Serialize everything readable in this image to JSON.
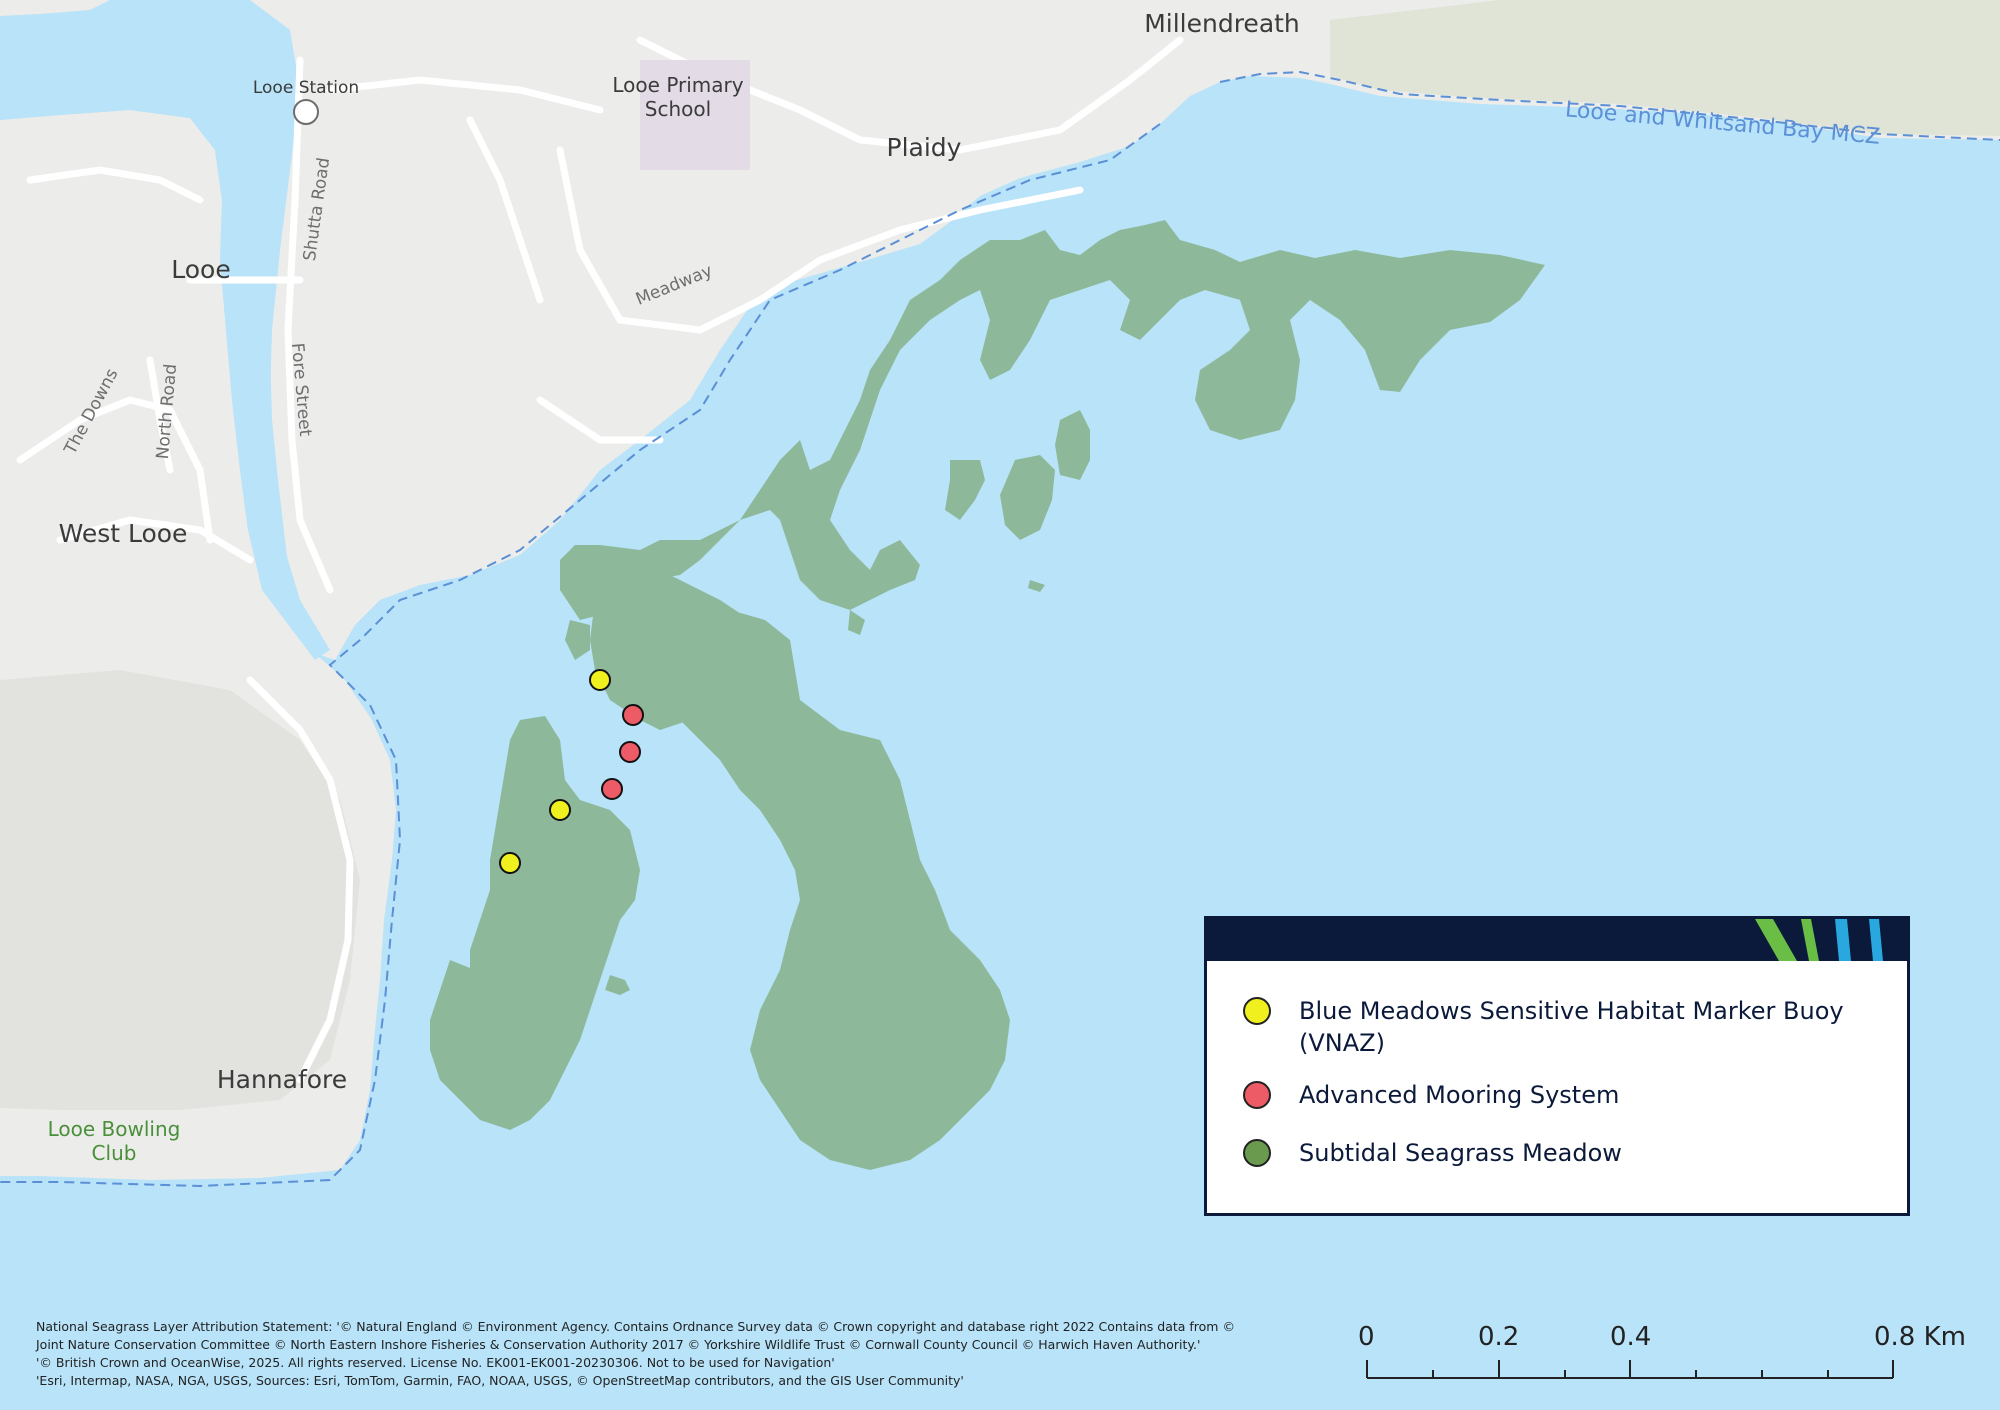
{
  "map": {
    "places": {
      "millendreath": "Millendreath",
      "looe_station": "Looe Station",
      "looe_primary_school_line1": "Looe Primary",
      "looe_primary_school_line2": "School",
      "plaidy": "Plaidy",
      "looe": "Looe",
      "west_looe": "West Looe",
      "hannafore": "Hannafore",
      "bowling_club_line1": "Looe Bowling",
      "bowling_club_line2": "Club",
      "mcz": "Looe and Whitsand Bay MCZ"
    },
    "roads": {
      "shutta_road": "Shutta Road",
      "fore_street": "Fore Street",
      "meadway": "Meadway",
      "the_downs": "The Downs",
      "north_road": "North Road"
    },
    "colors": {
      "sea": "#b8e3f9",
      "land": "#ececea",
      "seagrass": "#8db99a",
      "marker_buoy": "#f0f01e",
      "mooring": "#ec5b66",
      "legend_seagrass": "#6a9a4e",
      "legend_header": "#0b1a3a",
      "mcz_label": "#5b8fd6"
    }
  },
  "legend": {
    "items": [
      {
        "label": "Blue Meadows Sensitive Habitat Marker Buoy (VNAZ)",
        "color": "#f0f01e"
      },
      {
        "label": "Advanced Mooring System",
        "color": "#ec5b66"
      },
      {
        "label": "Subtidal Seagrass Meadow",
        "color": "#6a9a4e"
      }
    ]
  },
  "attribution": {
    "line1": "National Seagrass Layer Attribution Statement: '© Natural England © Environment Agency. Contains Ordnance Survey data © Crown copyright and database right 2022 Contains data from ©",
    "line2": "Joint Nature Conservation Committee © North Eastern Inshore Fisheries & Conservation Authority 2017 © Yorkshire Wildlife Trust © Cornwall County Council © Harwich Haven Authority.'",
    "line3": "'© British Crown and OceanWise, 2025. All rights reserved. License No. EK001-EK001-20230306. Not to be used for Navigation'",
    "line4": "'Esri, Intermap, NASA, NGA, USGS, Sources: Esri, TomTom, Garmin, FAO, NOAA, USGS, © OpenStreetMap contributors, and the GIS User Community'"
  },
  "scale_bar": {
    "labels": [
      "0",
      "0.2",
      "0.4",
      "0.8 Km"
    ]
  }
}
